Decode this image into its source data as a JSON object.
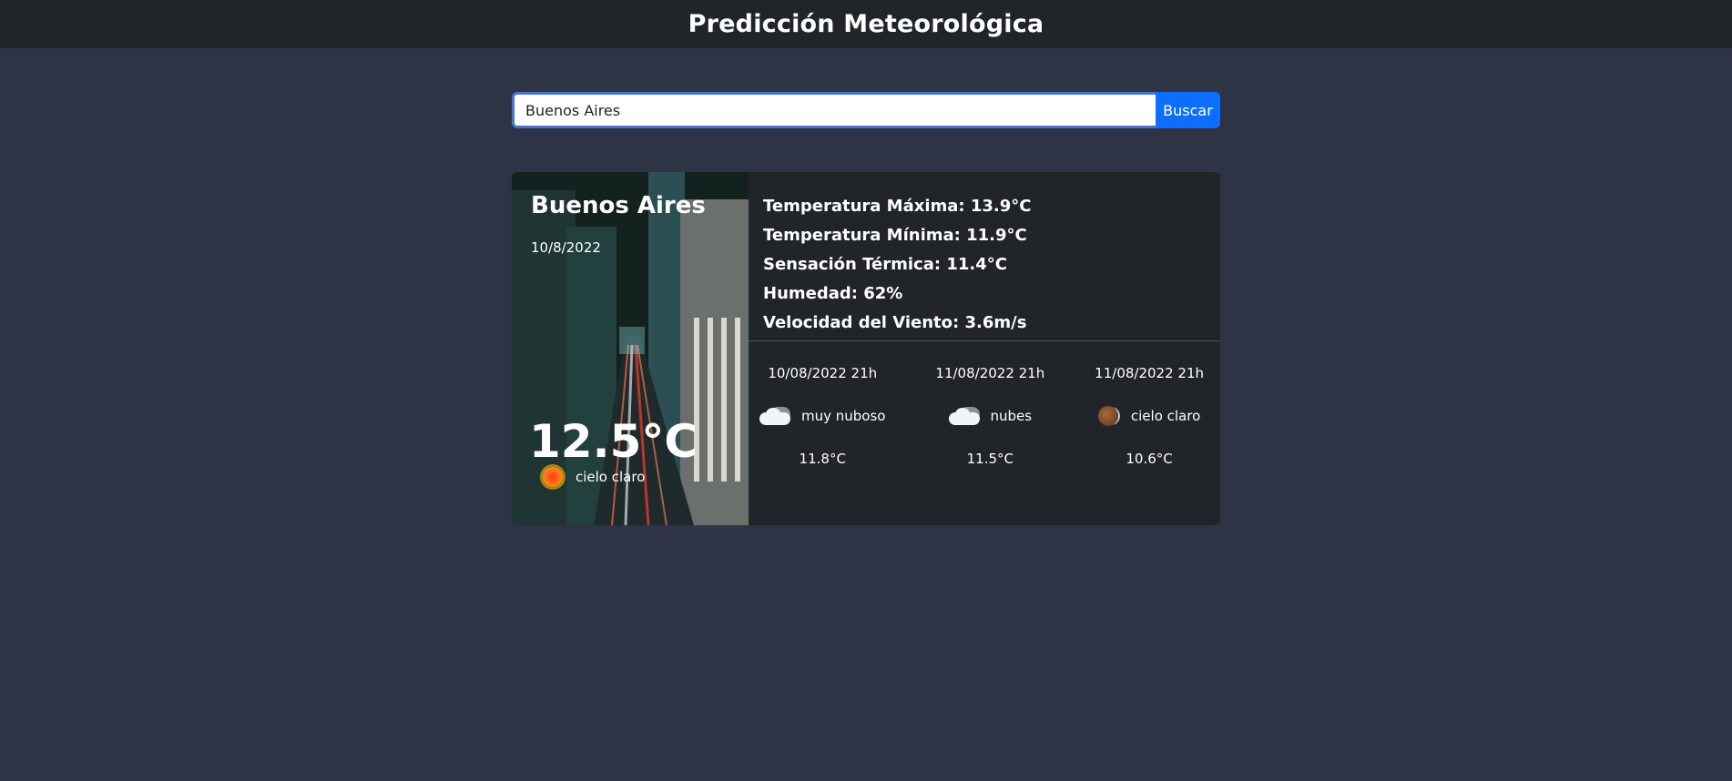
{
  "header": {
    "title": "Predicción Meteorológica"
  },
  "search": {
    "value": "Buenos Aires",
    "button_label": "Buscar"
  },
  "current": {
    "city": "Buenos Aires",
    "date": "10/8/2022",
    "temperature": "12.5°C",
    "condition": "cielo claro",
    "condition_icon": "sun-icon"
  },
  "details": {
    "max_temp": "Temperatura Máxima: 13.9°C",
    "min_temp": "Temperatura Mínima: 11.9°C",
    "feels_like": "Sensación Térmica: 11.4°C",
    "humidity": "Humedad: 62%",
    "wind": "Velocidad del Viento: 3.6m/s"
  },
  "forecast": [
    {
      "time": "10/08/2022 21h",
      "condition": "muy nuboso",
      "icon": "cloud-icon",
      "temp": "11.8°C"
    },
    {
      "time": "11/08/2022 21h",
      "condition": "nubes",
      "icon": "cloud-icon",
      "temp": "11.5°C"
    },
    {
      "time": "11/08/2022 21h",
      "condition": "cielo claro",
      "icon": "moon-icon",
      "temp": "10.6°C"
    }
  ],
  "colors": {
    "page_bg": "#2e3345",
    "navbar_bg": "#212529",
    "card_bg": "#212529",
    "button_bg": "#0d6efd",
    "input_focus_border": "#4a74c9"
  }
}
